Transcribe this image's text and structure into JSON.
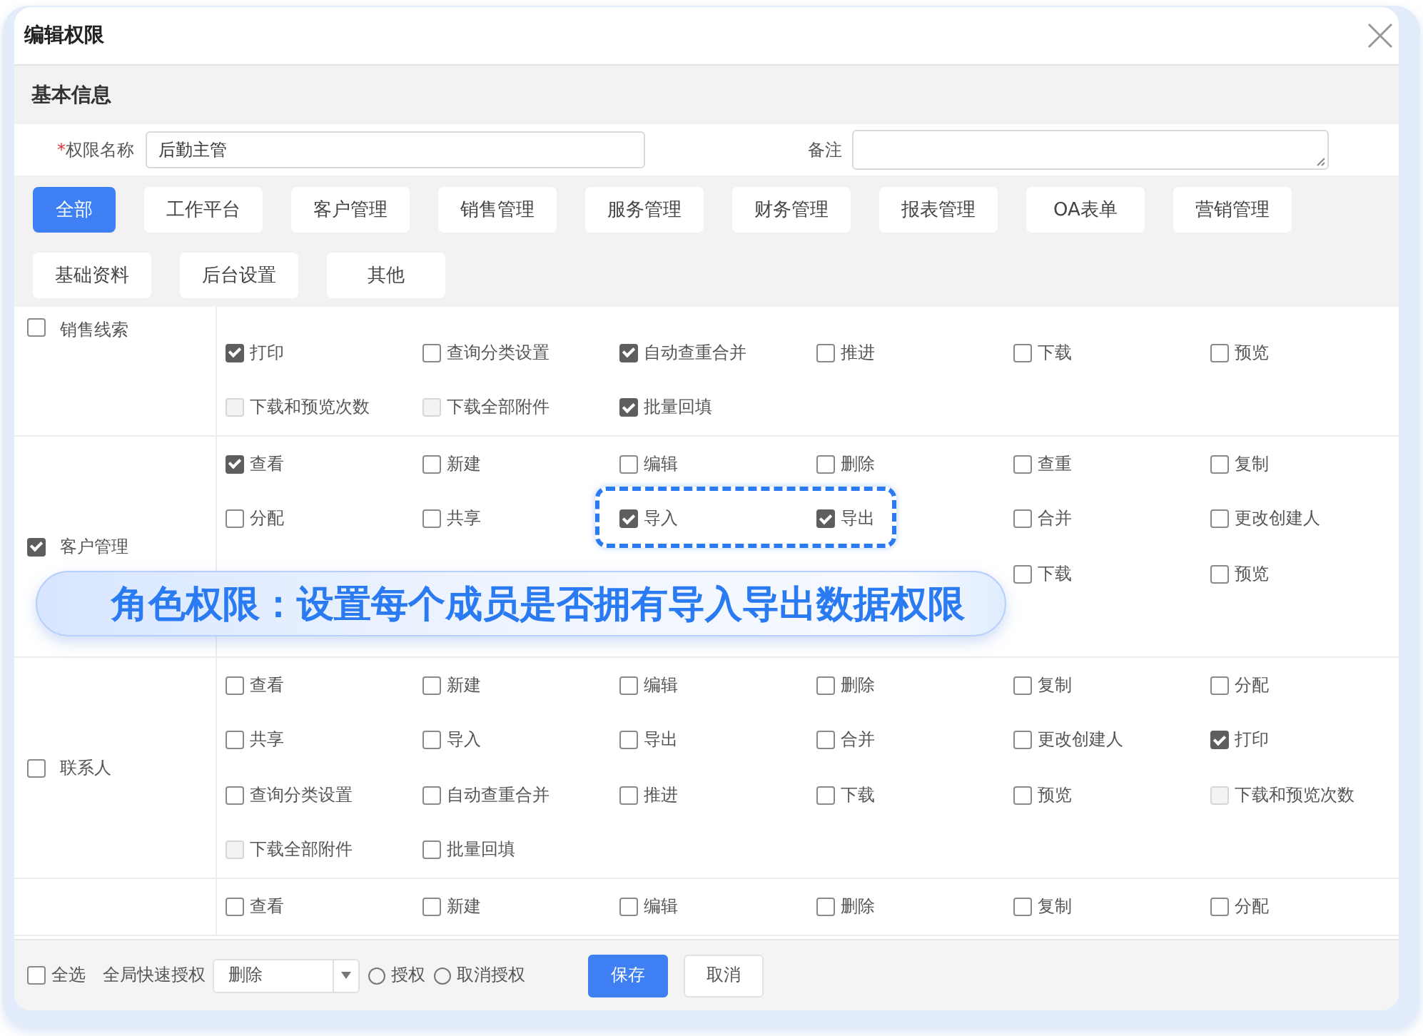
{
  "dialog": {
    "title": "编辑权限"
  },
  "basic_info": {
    "heading": "基本信息",
    "required_mark": "*",
    "name_label": "权限名称",
    "name_value": "后勤主管",
    "note_label": "备注"
  },
  "tabs": [
    {
      "label": "全部",
      "selected": true
    },
    {
      "label": "工作平台",
      "selected": false
    },
    {
      "label": "客户管理",
      "selected": false
    },
    {
      "label": "销售管理",
      "selected": false
    },
    {
      "label": "服务管理",
      "selected": false
    },
    {
      "label": "财务管理",
      "selected": false
    },
    {
      "label": "报表管理",
      "selected": false
    },
    {
      "label": "OA表单",
      "selected": false
    },
    {
      "label": "营销管理",
      "selected": false
    },
    {
      "label": "基础资料",
      "selected": false
    },
    {
      "label": "后台设置",
      "selected": false
    },
    {
      "label": "其他",
      "selected": false
    }
  ],
  "groups": [
    {
      "name": "销售线索",
      "checked": false,
      "items": [
        {
          "kind": "checkbox",
          "label": "打印",
          "checked": true,
          "disabled": false
        },
        {
          "kind": "checkbox",
          "label": "查询分类设置",
          "checked": false,
          "disabled": false
        },
        {
          "kind": "checkbox",
          "label": "自动查重合并",
          "checked": true,
          "disabled": false
        },
        {
          "kind": "checkbox",
          "label": "推进",
          "checked": false,
          "disabled": false
        },
        {
          "kind": "checkbox",
          "label": "下载",
          "checked": false,
          "disabled": false
        },
        {
          "kind": "checkbox",
          "label": "预览",
          "checked": false,
          "disabled": false
        },
        {
          "kind": "checkbox",
          "label": "下载和预览次数",
          "checked": false,
          "disabled": true
        },
        {
          "kind": "checkbox",
          "label": "下载全部附件",
          "checked": false,
          "disabled": true
        },
        {
          "kind": "checkbox",
          "label": "批量回填",
          "checked": true,
          "disabled": false
        }
      ]
    },
    {
      "name": "客户管理",
      "checked": true,
      "items": [
        {
          "kind": "checkbox",
          "label": "查看",
          "checked": true,
          "disabled": false
        },
        {
          "kind": "checkbox",
          "label": "新建",
          "checked": false,
          "disabled": false
        },
        {
          "kind": "checkbox",
          "label": "编辑",
          "checked": false,
          "disabled": false
        },
        {
          "kind": "checkbox",
          "label": "删除",
          "checked": false,
          "disabled": false
        },
        {
          "kind": "checkbox",
          "label": "查重",
          "checked": false,
          "disabled": false
        },
        {
          "kind": "checkbox",
          "label": "复制",
          "checked": false,
          "disabled": false
        },
        {
          "kind": "checkbox",
          "label": "分配",
          "checked": false,
          "disabled": false
        },
        {
          "kind": "checkbox",
          "label": "共享",
          "checked": false,
          "disabled": false
        },
        {
          "kind": "checkbox",
          "label": "导入",
          "checked": true,
          "disabled": false
        },
        {
          "kind": "checkbox",
          "label": "导出",
          "checked": true,
          "disabled": false
        },
        {
          "kind": "checkbox",
          "label": "合并",
          "checked": false,
          "disabled": false
        },
        {
          "kind": "checkbox",
          "label": "更改创建人",
          "checked": false,
          "disabled": false
        },
        {
          "kind": "covered"
        },
        {
          "kind": "covered"
        },
        {
          "kind": "covered"
        },
        {
          "kind": "covered"
        },
        {
          "kind": "checkbox",
          "label": "下载",
          "checked": false,
          "disabled": false
        },
        {
          "kind": "checkbox",
          "label": "预览",
          "checked": false,
          "disabled": false
        },
        {
          "kind": "covered"
        },
        {
          "kind": "covered"
        },
        {
          "kind": "covered"
        }
      ]
    },
    {
      "name": "联系人",
      "checked": false,
      "items": [
        {
          "kind": "checkbox",
          "label": "查看",
          "checked": false,
          "disabled": false
        },
        {
          "kind": "checkbox",
          "label": "新建",
          "checked": false,
          "disabled": false
        },
        {
          "kind": "checkbox",
          "label": "编辑",
          "checked": false,
          "disabled": false
        },
        {
          "kind": "checkbox",
          "label": "删除",
          "checked": false,
          "disabled": false
        },
        {
          "kind": "checkbox",
          "label": "复制",
          "checked": false,
          "disabled": false
        },
        {
          "kind": "checkbox",
          "label": "分配",
          "checked": false,
          "disabled": false
        },
        {
          "kind": "checkbox",
          "label": "共享",
          "checked": false,
          "disabled": false
        },
        {
          "kind": "checkbox",
          "label": "导入",
          "checked": false,
          "disabled": false
        },
        {
          "kind": "checkbox",
          "label": "导出",
          "checked": false,
          "disabled": false
        },
        {
          "kind": "checkbox",
          "label": "合并",
          "checked": false,
          "disabled": false
        },
        {
          "kind": "checkbox",
          "label": "更改创建人",
          "checked": false,
          "disabled": false
        },
        {
          "kind": "checkbox",
          "label": "打印",
          "checked": true,
          "disabled": false
        },
        {
          "kind": "checkbox",
          "label": "查询分类设置",
          "checked": false,
          "disabled": false
        },
        {
          "kind": "checkbox",
          "label": "自动查重合并",
          "checked": false,
          "disabled": false
        },
        {
          "kind": "checkbox",
          "label": "推进",
          "checked": false,
          "disabled": false
        },
        {
          "kind": "checkbox",
          "label": "下载",
          "checked": false,
          "disabled": false
        },
        {
          "kind": "checkbox",
          "label": "预览",
          "checked": false,
          "disabled": false
        },
        {
          "kind": "checkbox",
          "label": "下载和预览次数",
          "checked": false,
          "disabled": true
        },
        {
          "kind": "checkbox",
          "label": "下载全部附件",
          "checked": false,
          "disabled": true
        },
        {
          "kind": "checkbox",
          "label": "批量回填",
          "checked": false,
          "disabled": false
        }
      ]
    },
    {
      "items": [
        {
          "kind": "checkbox",
          "label": "查看",
          "checked": false,
          "disabled": false
        },
        {
          "kind": "checkbox",
          "label": "新建",
          "checked": false,
          "disabled": false
        },
        {
          "kind": "checkbox",
          "label": "编辑",
          "checked": false,
          "disabled": false
        },
        {
          "kind": "checkbox",
          "label": "删除",
          "checked": false,
          "disabled": false
        },
        {
          "kind": "checkbox",
          "label": "复制",
          "checked": false,
          "disabled": false
        },
        {
          "kind": "checkbox",
          "label": "分配",
          "checked": false,
          "disabled": false
        }
      ]
    }
  ],
  "annotation": {
    "text": "角色权限：设置每个成员是否拥有导入导出数据权限",
    "highlight": true
  },
  "footer": {
    "select_all": {
      "label": "全选",
      "checked": false
    },
    "quick_label": "全局快速授权",
    "quick_value": "删除",
    "options": [
      {
        "label": "授权",
        "selected": false
      },
      {
        "label": "取消授权",
        "selected": false
      }
    ],
    "buttons": [
      {
        "label": "保存",
        "kind": "primary"
      },
      {
        "label": "取消",
        "kind": "default"
      }
    ]
  }
}
